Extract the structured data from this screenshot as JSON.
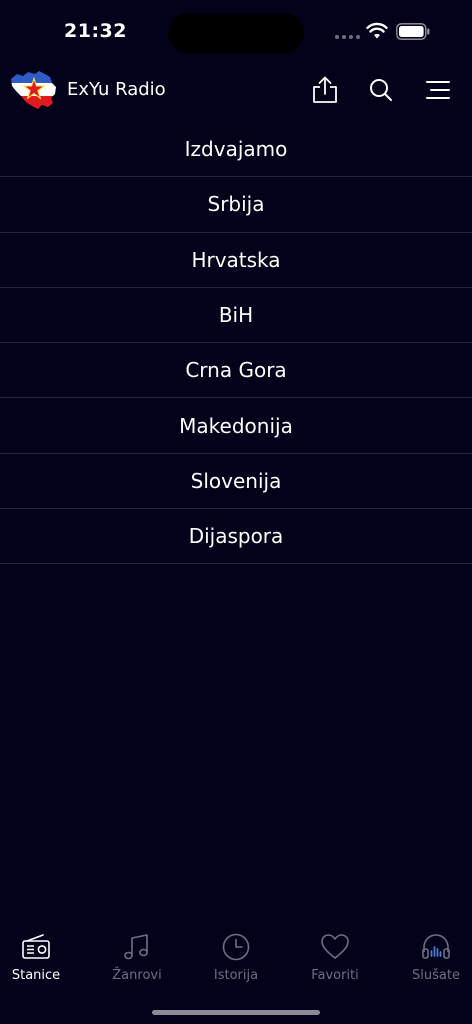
{
  "status": {
    "time": "21:32"
  },
  "header": {
    "title": "ExYu Radio"
  },
  "regions": [
    {
      "label": "Izdvajamo"
    },
    {
      "label": "Srbija"
    },
    {
      "label": "Hrvatska"
    },
    {
      "label": "BiH"
    },
    {
      "label": "Crna Gora"
    },
    {
      "label": "Makedonija"
    },
    {
      "label": "Slovenija"
    },
    {
      "label": "Dijaspora"
    }
  ],
  "tabs": [
    {
      "label": "Stanice",
      "icon": "radio-icon",
      "active": true
    },
    {
      "label": "Žanrovi",
      "icon": "music-note-icon",
      "active": false
    },
    {
      "label": "Istorija",
      "icon": "clock-icon",
      "active": false
    },
    {
      "label": "Favoriti",
      "icon": "heart-icon",
      "active": false
    },
    {
      "label": "Slušate",
      "icon": "headphones-icon",
      "active": false
    }
  ],
  "colors": {
    "background": "#02031a",
    "divider": "#23253a",
    "active_tab": "#ffffff",
    "inactive_tab": "#6d6f80",
    "accent": "#4a7bd0"
  }
}
